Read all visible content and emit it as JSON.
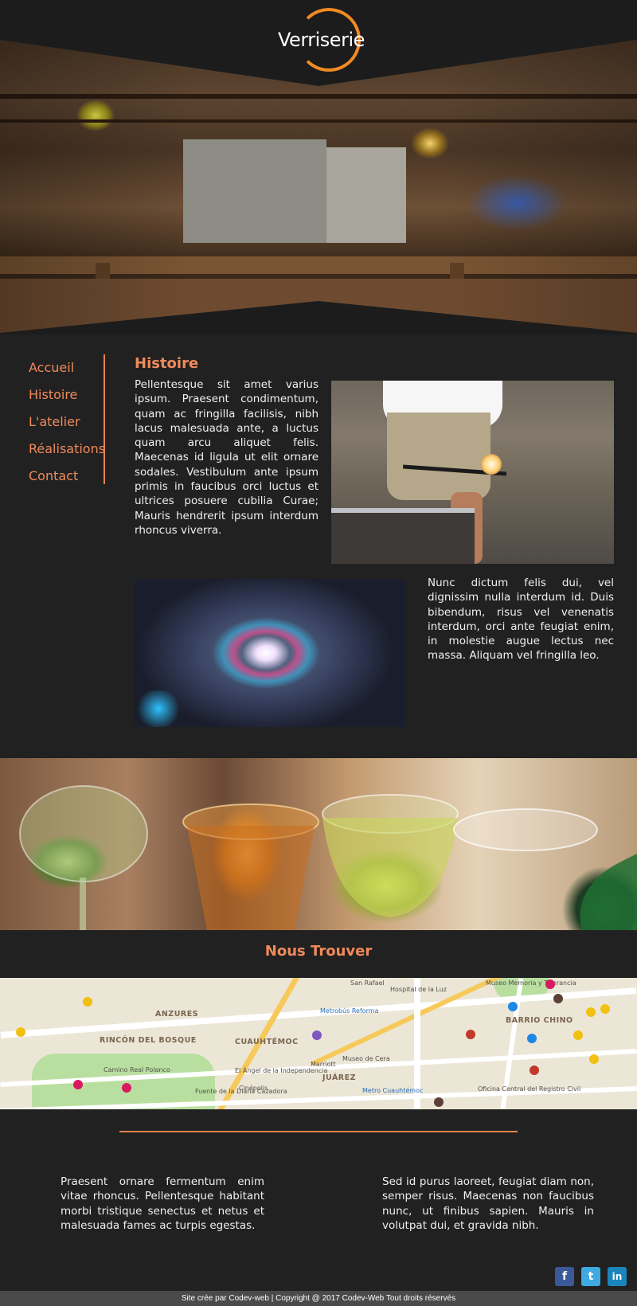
{
  "brand": {
    "logo_text": "Verriserie",
    "accent_color": "#f08a24"
  },
  "nav": {
    "items": [
      {
        "label": "Accueil"
      },
      {
        "label": "Histoire"
      },
      {
        "label": "L'atelier"
      },
      {
        "label": "Réalisations"
      },
      {
        "label": "Contact"
      }
    ]
  },
  "histoire": {
    "title": "Histoire",
    "paragraph_1": "Pellentesque sit amet varius ipsum. Praesent condimentum, quam ac fringilla facilisis, nibh lacus malesuada ante, a luctus quam arcu aliquet felis. Maecenas id ligula ut elit ornare sodales. Vestibulum ante ipsum primis in faucibus orci luctus et ultrices posuere cubilia Curae; Mauris hendrerit ipsum interdum rhoncus viverra.",
    "paragraph_2": "Nunc dictum felis dui, vel dignissim nulla interdum id. Duis bibendum, risus vel venenatis interdum, orci ante feugiat enim, in molestie augue lectus nec massa. Aliquam vel fringilla leo."
  },
  "find": {
    "title": "Nous Trouver",
    "map_labels": [
      "San Rafael",
      "Hospital de la Luz",
      "Museo Memoria y Tolerancia",
      "ANZURES",
      "BARRIO CHINO",
      "RINCÓN DEL BOSQUE",
      "CUAUHTÉMOC",
      "Camino Real Polanco",
      "El Ángel de la Independencia",
      "Museo de Cera",
      "JUÁREZ",
      "Marriott",
      "Fuente de la Diana Cazadora",
      "Cinépolis",
      "Oficina Central del Registro Civil",
      "Metro Cuauhtémoc",
      "Metrobús Reforma"
    ]
  },
  "footer": {
    "left_text": "Praesent ornare fermentum enim vitae rhoncus. Pellentesque habitant morbi tristique senectus et netus et malesuada fames ac turpis egestas.",
    "right_text": "Sed id purus laoreet, feugiat diam non, semper risus. Maecenas non faucibus nunc, ut finibus sapien. Mauris in volutpat dui, et gravida nibh.",
    "social": [
      {
        "icon": "facebook-icon",
        "glyph": "f",
        "color": "#3b5998"
      },
      {
        "icon": "twitter-icon",
        "glyph": "t",
        "color": "#3fa9e1"
      },
      {
        "icon": "linkedin-icon",
        "glyph": "in",
        "color": "#1a85bc"
      }
    ],
    "copyright": "Site crée par Codev-web | Copyright @ 2017 Codev-Web Tout droits réservés"
  }
}
